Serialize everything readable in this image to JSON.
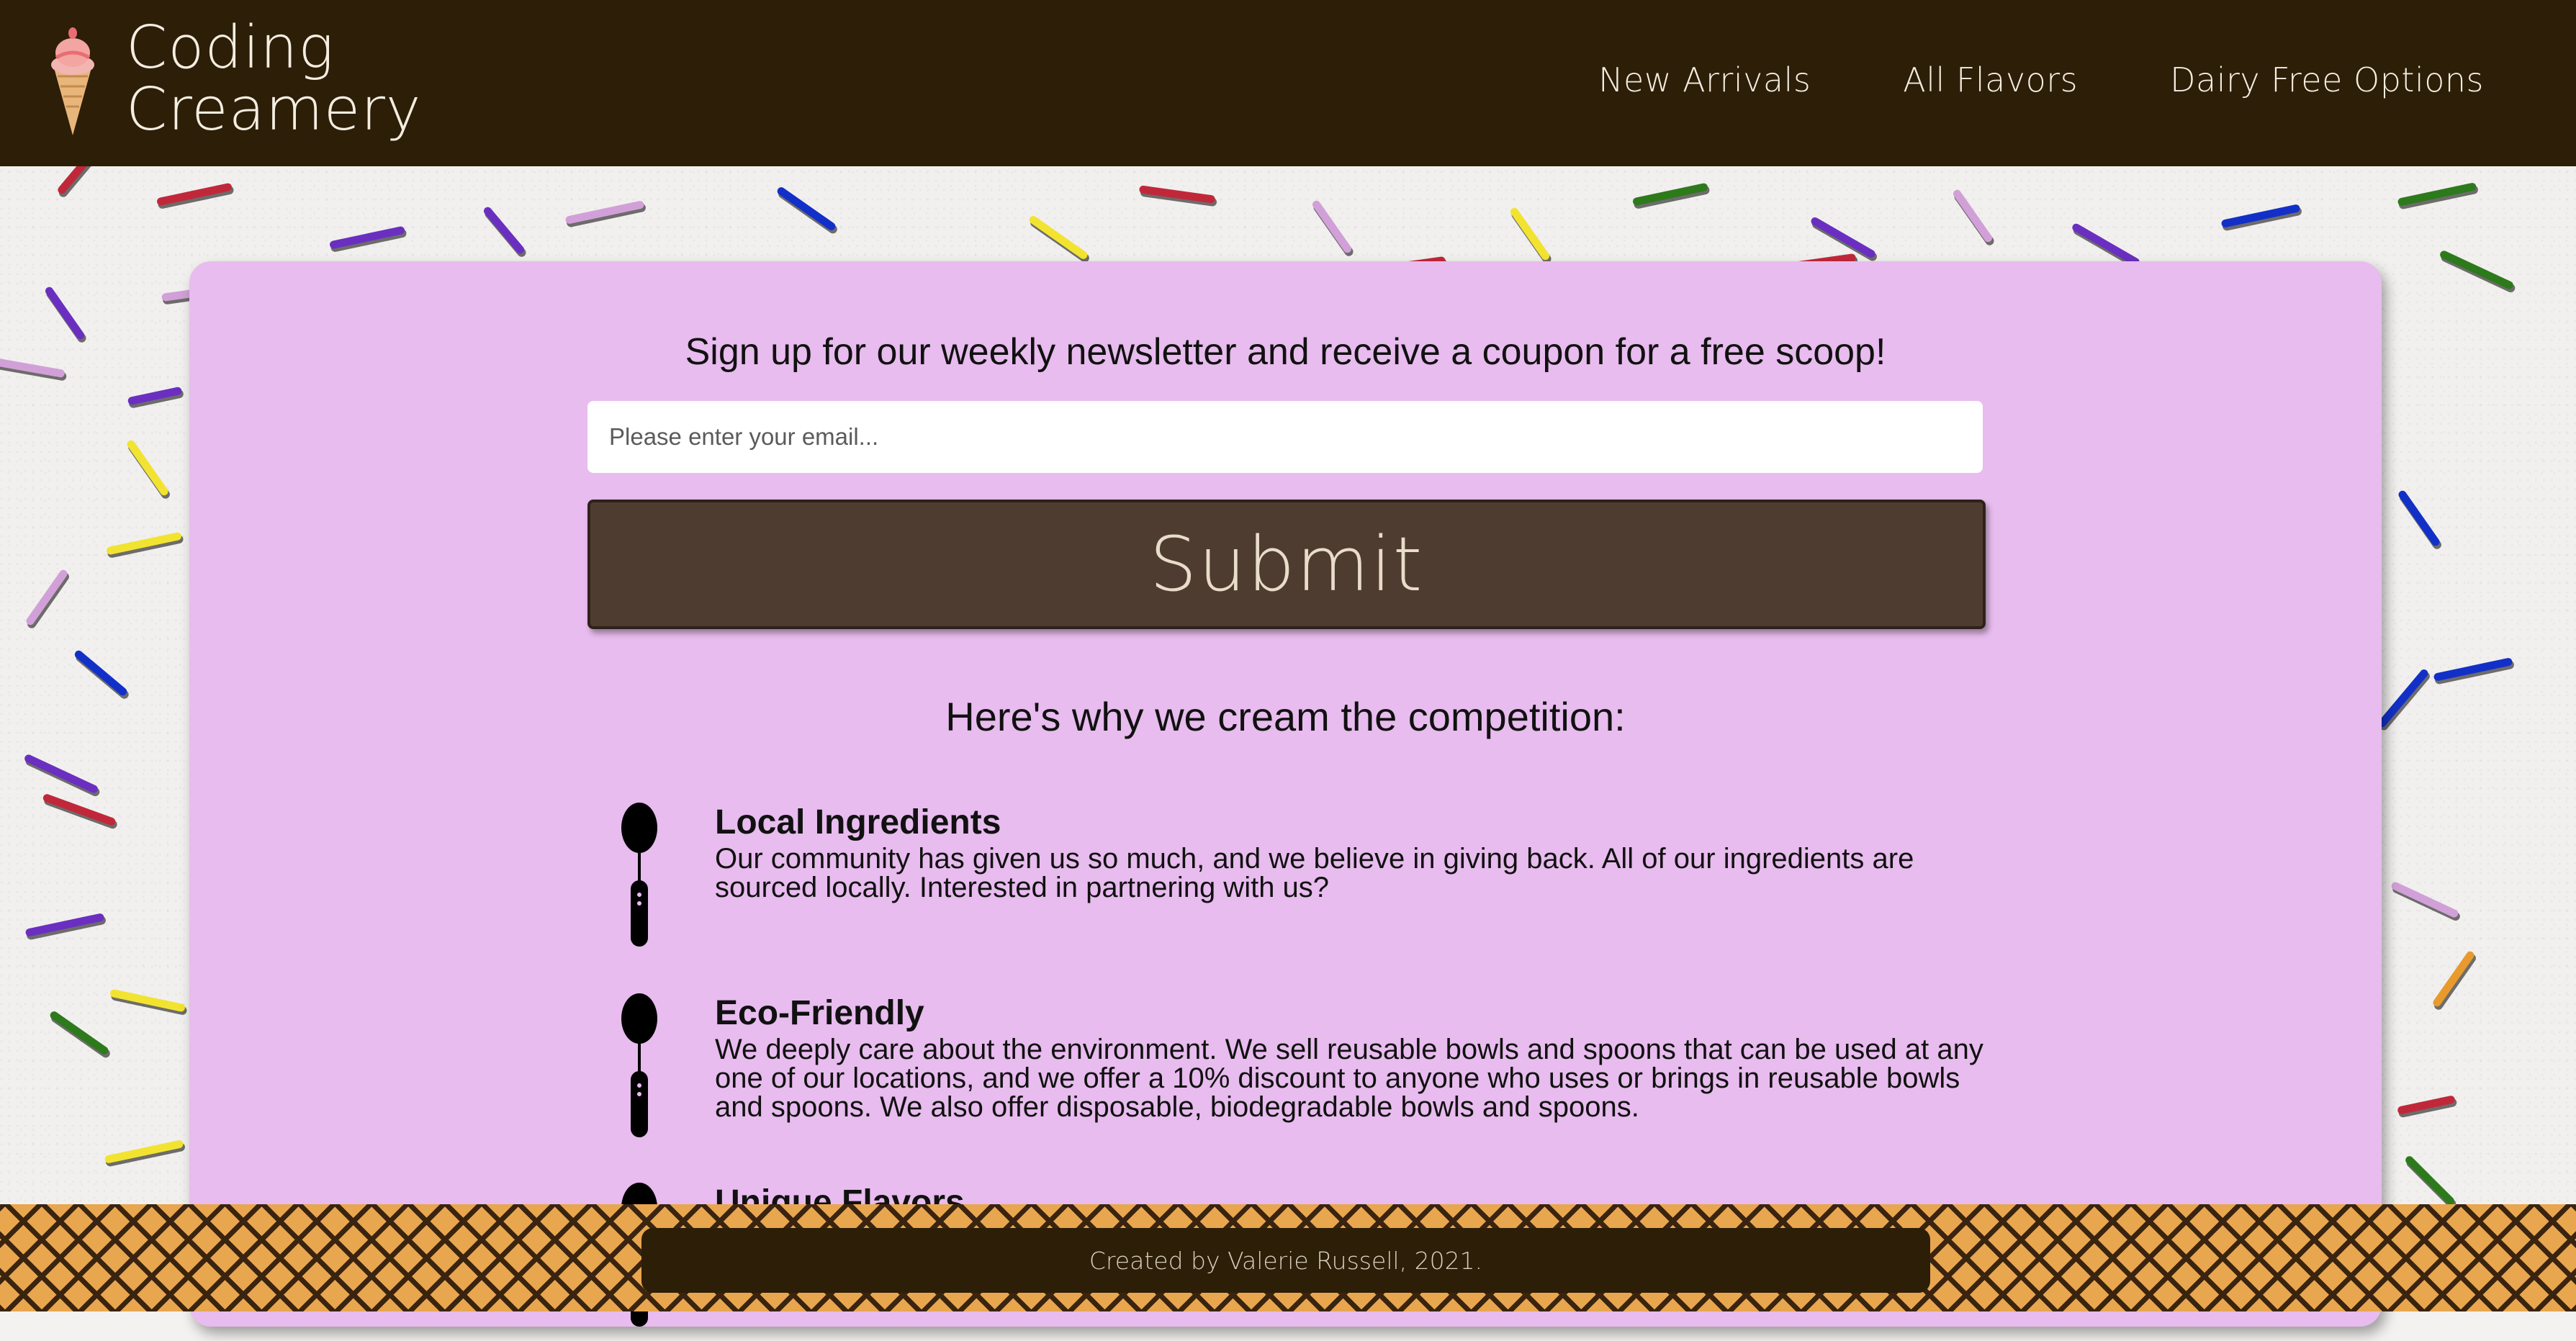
{
  "header": {
    "brand_line1": "Coding",
    "brand_line2": "Creamery",
    "nav": [
      "New Arrivals",
      "All Flavors",
      "Dairy Free Options"
    ]
  },
  "newsletter": {
    "title": "Sign up for our weekly newsletter and receive a coupon for a free scoop!",
    "email_placeholder": "Please enter your email...",
    "submit_label": "Submit"
  },
  "why": {
    "title": "Here's why we cream the competition:",
    "features": [
      {
        "title": "Local Ingredients",
        "text": "Our community has given us so much, and we believe in giving back. All of our ingredients are sourced locally. Interested in partnering with us?"
      },
      {
        "title": "Eco-Friendly",
        "text": "We deeply care about the environment. We sell reusable bowls and spoons that can be used at any one of our locations, and we offer a 10% discount to anyone who uses or brings in reusable bowls and spoons. We also offer disposable, biodegradable bowls and spoons."
      },
      {
        "title": "Unique Flavors",
        "text": ""
      }
    ]
  },
  "footer": {
    "credit": "Created by Valerie Russell, 2021."
  },
  "colors": {
    "header_bg": "#2c1e07",
    "panel_bg": "#e8bcee",
    "button_bg": "#4f3c30",
    "sprinkle_colors": [
      "#c0283a",
      "#6a2fc1",
      "#d2a0d8",
      "#f2e331",
      "#1230c8",
      "#2d7a1c",
      "#e89a2c"
    ]
  }
}
